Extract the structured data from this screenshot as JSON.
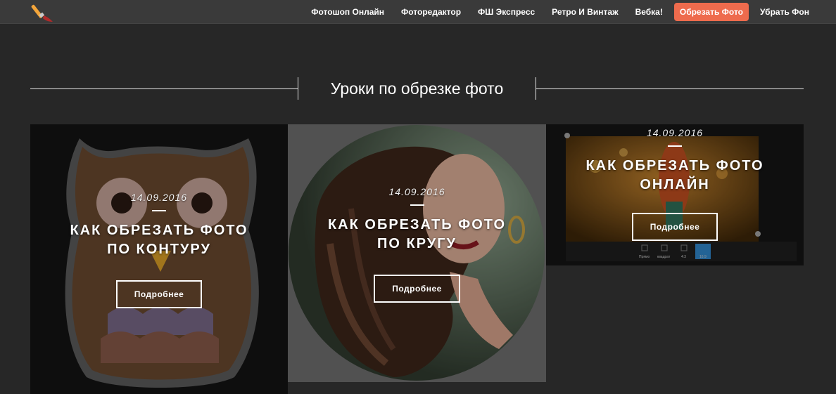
{
  "header": {
    "logo_icon": "paintbrush-icon",
    "nav": [
      {
        "label": "Фотошоп Онлайн",
        "active": false
      },
      {
        "label": "Фоторедактор",
        "active": false
      },
      {
        "label": "ФШ Экспресс",
        "active": false
      },
      {
        "label": "Ретро И Винтаж",
        "active": false
      },
      {
        "label": "Вебка!",
        "active": false
      },
      {
        "label": "Обрезать Фото",
        "active": true
      },
      {
        "label": "Убрать Фон",
        "active": false
      }
    ],
    "accent_color": "#ee6b4d"
  },
  "section": {
    "title": "Уроки по обрезке фото"
  },
  "cards": [
    {
      "date": "14.09.2016",
      "title_line1": "КАК ОБРЕЗАТЬ ФОТО",
      "title_line2": "ПО КОНТУРУ",
      "button": "Подробнее",
      "image": "felt-owl-image"
    },
    {
      "date": "14.09.2016",
      "title_line1": "КАК ОБРЕЗАТЬ ФОТО",
      "title_line2": "ПО КРУГУ",
      "button": "Подробнее",
      "image": "woman-portrait-circle-image"
    },
    {
      "date": "14.09.2016",
      "title_line1": "КАК ОБРЕЗАТЬ ФОТО",
      "title_line2": "ОНЛАЙН",
      "button": "Подробнее",
      "image": "crop-editor-screenshot-image",
      "editor_toolbar": [
        "Прямо",
        "квадрат",
        "4:3",
        "16:9"
      ]
    }
  ]
}
